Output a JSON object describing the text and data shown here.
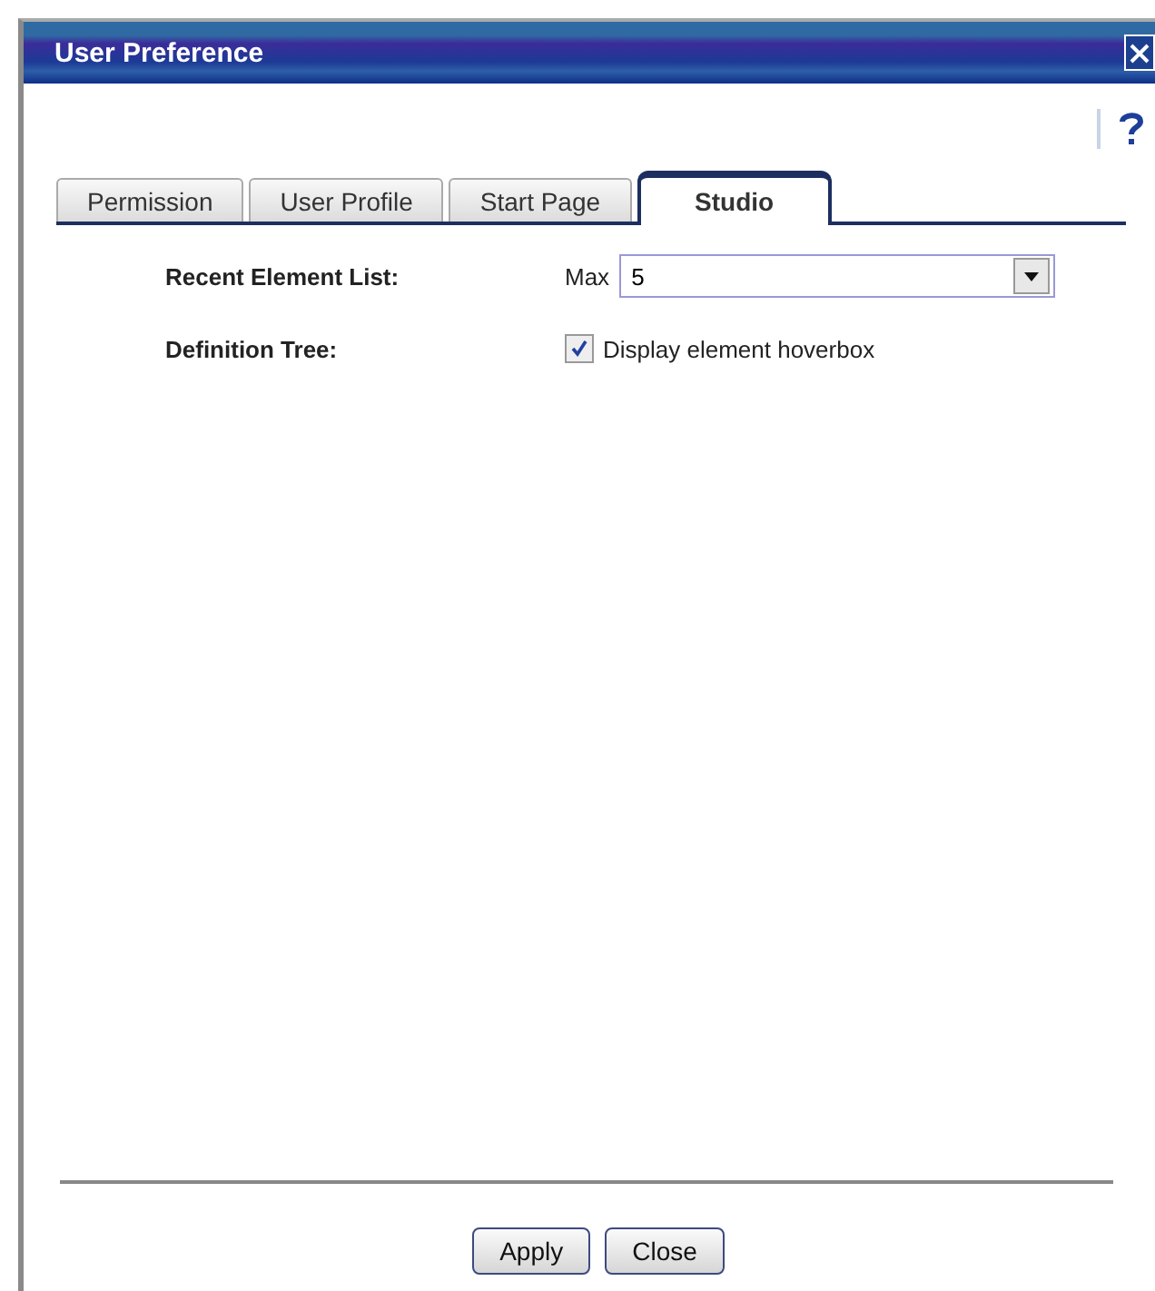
{
  "window": {
    "title": "User Preference"
  },
  "tabs": [
    {
      "label": "Permission",
      "selected": false
    },
    {
      "label": "User Profile",
      "selected": false
    },
    {
      "label": "Start Page",
      "selected": false
    },
    {
      "label": "Studio",
      "selected": true
    }
  ],
  "settings": [
    {
      "kind": "select",
      "label": "Recent Element List:",
      "prefix": "Max",
      "value": "5"
    },
    {
      "kind": "checkbox",
      "label": "Definition Tree:",
      "text": "Display element hoverbox",
      "checked": true
    }
  ],
  "buttons": [
    "Apply",
    "Close"
  ]
}
